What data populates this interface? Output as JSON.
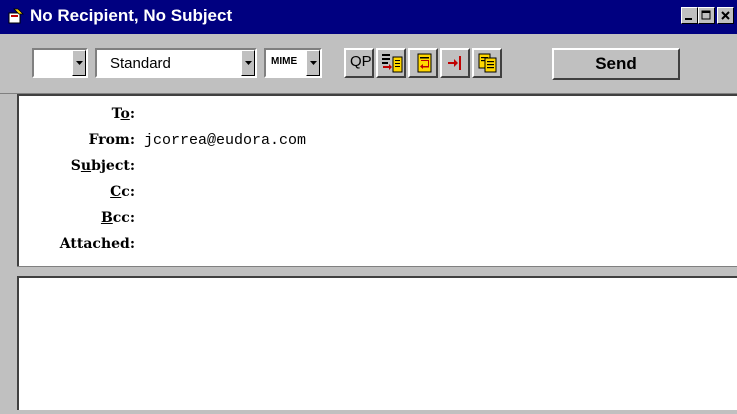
{
  "window": {
    "title": "No Recipient, No Subject"
  },
  "toolbar": {
    "priority_value": "",
    "signature_value": "Standard",
    "encoding_value": "MIME",
    "qp_label": "QP",
    "send_label": "Send"
  },
  "header": {
    "to": {
      "label_before": "T",
      "label_u": "o",
      "label_after": ":",
      "value": ""
    },
    "from": {
      "label_before": "From",
      "label_u": "",
      "label_after": ":",
      "value": "jcorrea@eudora.com"
    },
    "subject": {
      "label_before": "S",
      "label_u": "u",
      "label_after": "bject:",
      "value": ""
    },
    "cc": {
      "label_before": "",
      "label_u": "C",
      "label_after": "c:",
      "value": ""
    },
    "bcc": {
      "label_before": "",
      "label_u": "B",
      "label_after": "cc:",
      "value": ""
    },
    "attached": {
      "label_before": "Attached",
      "label_u": "",
      "label_after": ":",
      "value": ""
    }
  },
  "body": {
    "text": ""
  },
  "colors": {
    "titlebar": "#000080",
    "chrome": "#c0c0c0",
    "icon_yellow": "#ffd700",
    "icon_red": "#c00000"
  }
}
